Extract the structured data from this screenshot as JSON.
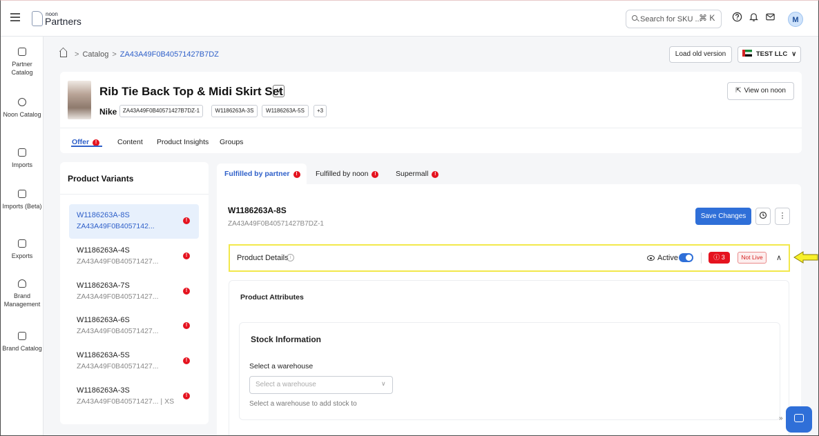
{
  "topbar": {
    "logo_small": "noon",
    "logo_big": "Partners",
    "search_placeholder": "Search for SKU ...",
    "search_shortcut": "⌘ K",
    "avatar_initial": "M"
  },
  "sidebar": {
    "items": [
      {
        "label": "Partner Catalog",
        "icon": "partner-catalog-icon"
      },
      {
        "label": "Noon Catalog",
        "icon": "noon-catalog-icon"
      },
      {
        "label": "Imports",
        "icon": "imports-icon"
      },
      {
        "label": "Imports (Beta)",
        "icon": "imports-beta-icon"
      },
      {
        "label": "Exports",
        "icon": "exports-icon"
      },
      {
        "label": "Brand Management",
        "icon": "brand-management-icon"
      },
      {
        "label": "Brand Catalog",
        "icon": "brand-catalog-icon"
      }
    ]
  },
  "breadcrumb": {
    "catalog": "Catalog",
    "current": "ZA43A49F0B40571427B7DZ"
  },
  "actions": {
    "load_old_version": "Load old version",
    "account": "TEST LLC"
  },
  "product": {
    "title": "Rib Tie Back Top & Midi Skirt Set",
    "brand": "Nike",
    "chips": [
      "ZA43A49F0B40571427B7DZ-1",
      "W1186263A-3S",
      "W1186263A-5S",
      "+3"
    ],
    "view_on_noon": "View on noon"
  },
  "tabs": [
    {
      "label": "Offer",
      "active": true,
      "error": true
    },
    {
      "label": "Content",
      "active": false,
      "error": false
    },
    {
      "label": "Product Insights",
      "active": false,
      "error": false
    },
    {
      "label": "Groups",
      "active": false,
      "error": false
    }
  ],
  "variants": {
    "title": "Product Variants",
    "items": [
      {
        "sku": "W1186263A-8S",
        "psku": "ZA43A49F0B4057142...",
        "selected": true
      },
      {
        "sku": "W1186263A-4S",
        "psku": "ZA43A49F0B40571427...",
        "selected": false
      },
      {
        "sku": "W1186263A-7S",
        "psku": "ZA43A49F0B40571427...",
        "selected": false
      },
      {
        "sku": "W1186263A-6S",
        "psku": "ZA43A49F0B40571427...",
        "selected": false
      },
      {
        "sku": "W1186263A-5S",
        "psku": "ZA43A49F0B40571427...",
        "selected": false
      },
      {
        "sku": "W1186263A-3S",
        "psku": "ZA43A49F0B40571427...  |  XS",
        "selected": false
      }
    ]
  },
  "fulfillment_tabs": [
    {
      "label": "Fulfilled by partner",
      "active": true
    },
    {
      "label": "Fulfilled by noon",
      "active": false
    },
    {
      "label": "Supermall",
      "active": false
    }
  ],
  "detail": {
    "sku": "W1186263A-8S",
    "psku": "ZA43A49F0B40571427B7DZ-1",
    "save_changes": "Save Changes",
    "product_details_label": "Product Details",
    "active_label": "Active",
    "error_count": "3",
    "status": "Not Live",
    "attributes_title": "Product Attributes",
    "stock_title": "Stock Information",
    "warehouse_label": "Select a warehouse",
    "warehouse_placeholder": "Select a warehouse",
    "warehouse_help": "Select a warehouse to add stock to"
  },
  "colors": {
    "primary": "#2f6fd8",
    "error": "#e5131f",
    "highlight": "#f2e84a"
  }
}
